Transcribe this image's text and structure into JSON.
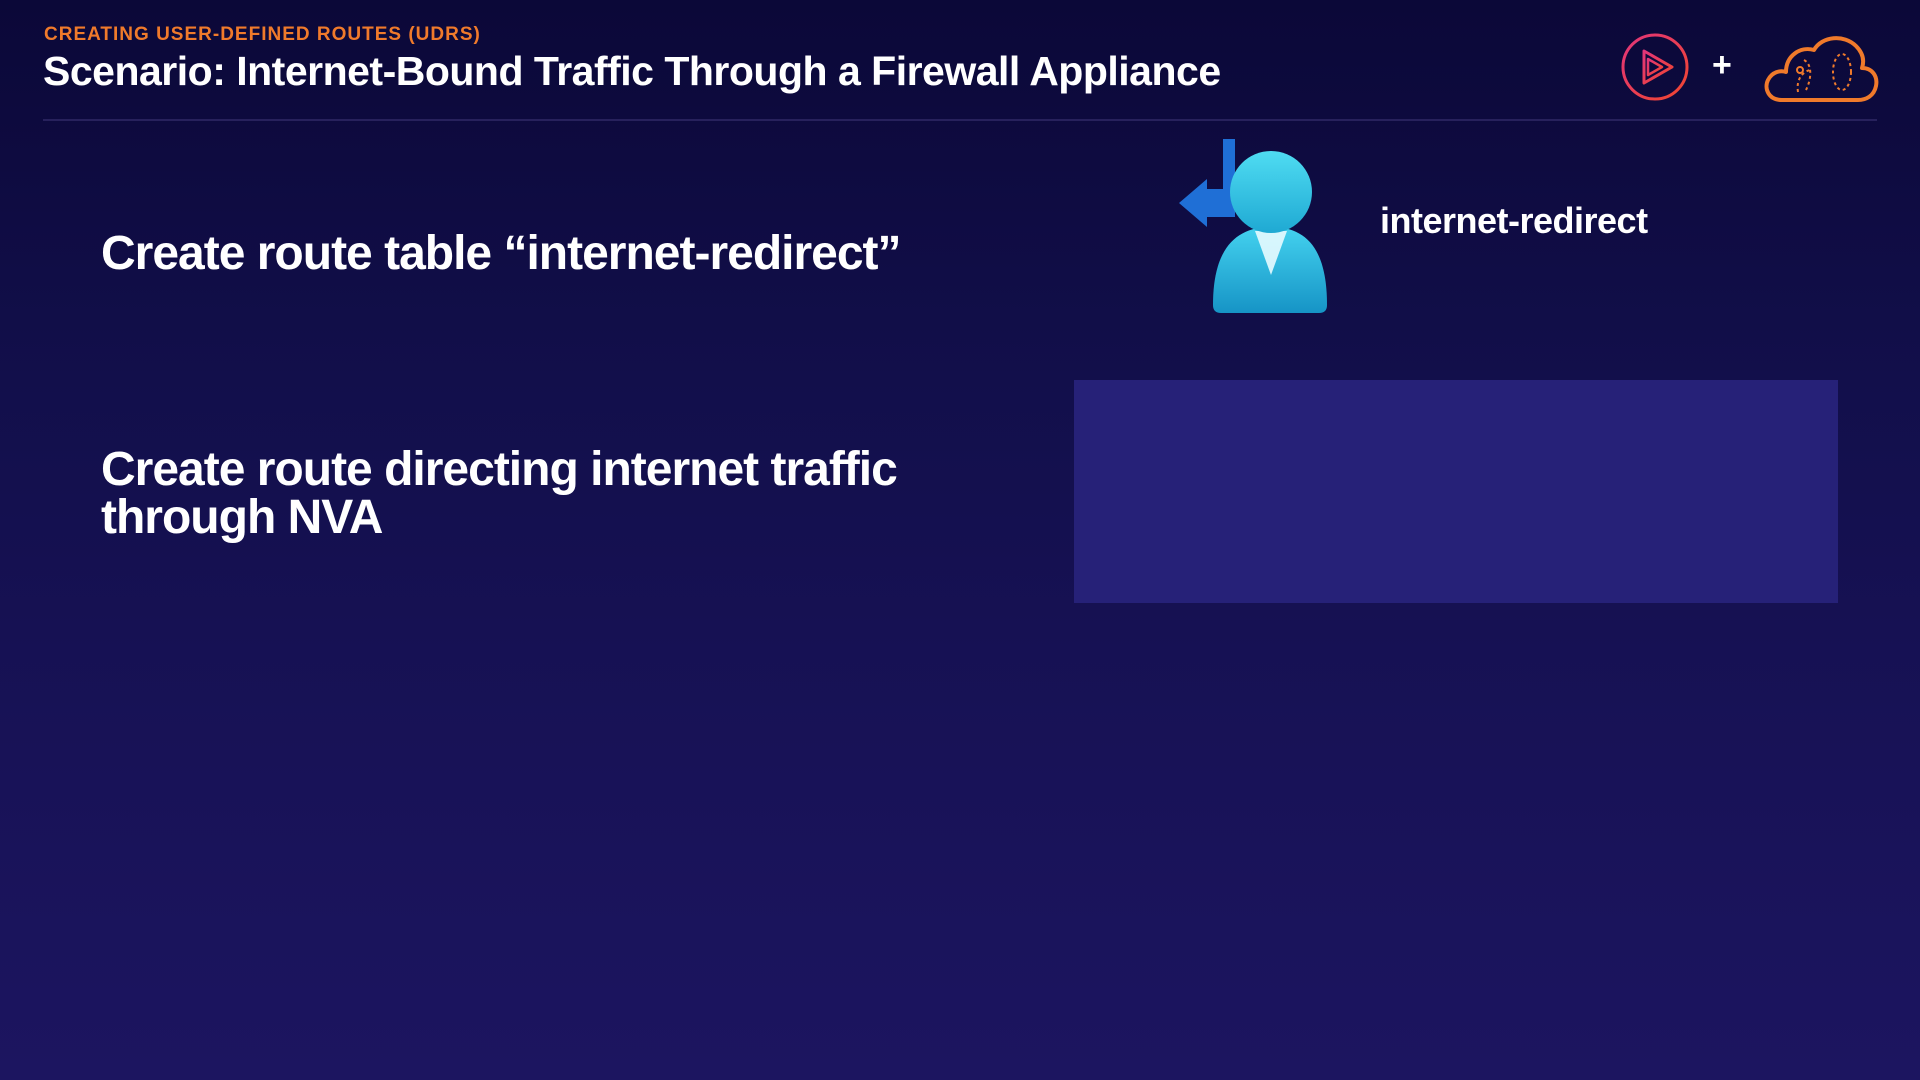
{
  "header": {
    "kicker": "CREATING USER-DEFINED ROUTES (UDRS)",
    "title": "Scenario: Internet-Bound Traffic Through a Firewall Appliance"
  },
  "branding": {
    "left_logo_icon": "play-logo-icon",
    "plus": "+",
    "right_logo_icon": "cloud-logo-icon"
  },
  "steps": [
    {
      "text": "Create route table “internet-redirect”"
    },
    {
      "text": "Create route directing internet traffic through NVA"
    }
  ],
  "route_table": {
    "icon": "route-table-icon",
    "name": "internet-redirect"
  },
  "colors": {
    "accent_orange": "#f07a2b",
    "logo_red": "#d7345a",
    "icon_cyan": "#32c7e6",
    "arrow_blue": "#1f6fd6",
    "panel": "#262178"
  }
}
